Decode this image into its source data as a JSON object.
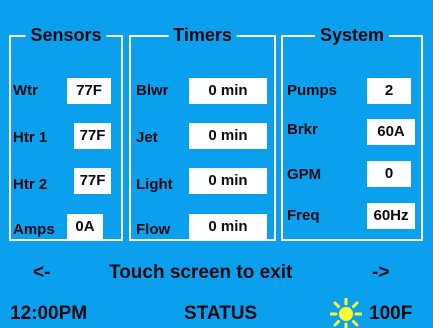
{
  "sensors": {
    "title": "Sensors",
    "rows": [
      {
        "label": "Wtr",
        "value": "77F"
      },
      {
        "label": "Htr 1",
        "value": "77F"
      },
      {
        "label": "Htr 2",
        "value": "77F"
      },
      {
        "label": "Amps",
        "value": "0A"
      }
    ]
  },
  "timers": {
    "title": "Timers",
    "rows": [
      {
        "label": "Blwr",
        "value": "0 min"
      },
      {
        "label": "Jet",
        "value": "0 min"
      },
      {
        "label": "Light",
        "value": "0 min"
      },
      {
        "label": "Flow",
        "value": "0 min"
      }
    ]
  },
  "system": {
    "title": "System",
    "rows": [
      {
        "label": "Pumps",
        "value": "2"
      },
      {
        "label": "Brkr",
        "value": "60A"
      },
      {
        "label": "GPM",
        "value": "0"
      },
      {
        "label": "Freq",
        "value": "60Hz"
      }
    ]
  },
  "nav": {
    "prev_label": "<-",
    "message": "Touch screen to exit",
    "next_label": "->"
  },
  "status_bar": {
    "time": "12:00PM",
    "status_label": "STATUS",
    "weather_icon": "sun-icon",
    "outside_temp": "100F"
  },
  "colors": {
    "background": "#0aa0ee",
    "box": "#ffffff",
    "text": "#0a0a12",
    "sun": "#ffff33"
  }
}
